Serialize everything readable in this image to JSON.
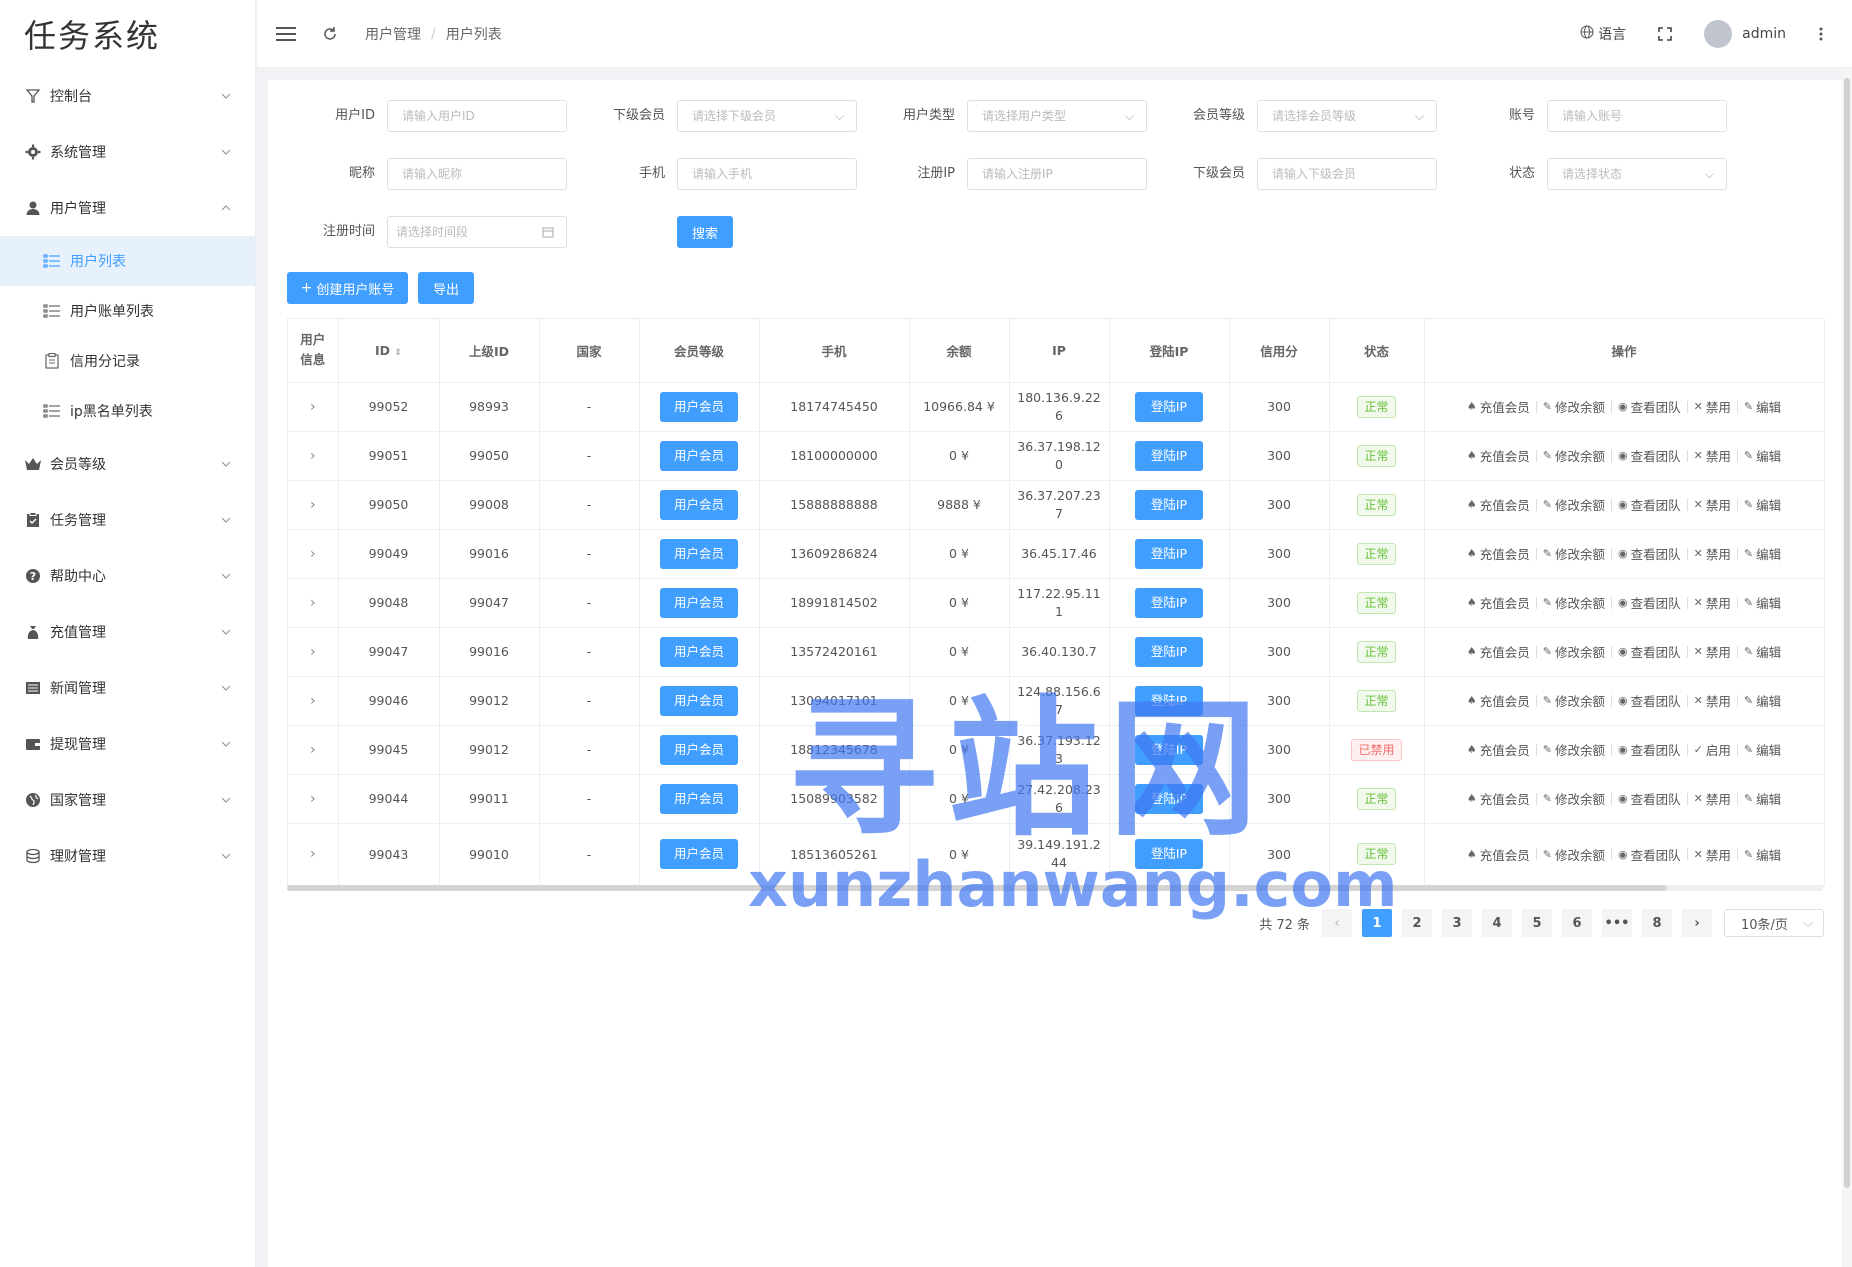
{
  "app": {
    "title": "任务系统"
  },
  "sidebar": {
    "items": [
      {
        "label": "控制台",
        "icon": "dashboard-icon",
        "expanded": false
      },
      {
        "label": "系统管理",
        "icon": "gear-icon",
        "expanded": false
      },
      {
        "label": "用户管理",
        "icon": "user-icon",
        "expanded": true,
        "children": [
          {
            "label": "用户列表",
            "icon": "list-icon",
            "active": true
          },
          {
            "label": "用户账单列表",
            "icon": "list-icon",
            "active": false
          },
          {
            "label": "信用分记录",
            "icon": "clipboard-icon",
            "active": false
          },
          {
            "label": "ip黑名单列表",
            "icon": "list-icon",
            "active": false
          }
        ]
      },
      {
        "label": "会员等级",
        "icon": "crown-icon",
        "expanded": false
      },
      {
        "label": "任务管理",
        "icon": "task-icon",
        "expanded": false
      },
      {
        "label": "帮助中心",
        "icon": "question-icon",
        "expanded": false
      },
      {
        "label": "充值管理",
        "icon": "money-bag-icon",
        "expanded": false
      },
      {
        "label": "新闻管理",
        "icon": "news-icon",
        "expanded": false
      },
      {
        "label": "提现管理",
        "icon": "wallet-icon",
        "expanded": false
      },
      {
        "label": "国家管理",
        "icon": "globe-icon",
        "expanded": false
      },
      {
        "label": "理财管理",
        "icon": "coins-icon",
        "expanded": false
      }
    ]
  },
  "header": {
    "breadcrumb": [
      "用户管理",
      "用户列表"
    ],
    "language_label": "语言",
    "username": "admin"
  },
  "filters": {
    "user_id": {
      "label": "用户ID",
      "placeholder": "请输入用户ID"
    },
    "sub_member": {
      "label": "下级会员",
      "placeholder": "请选择下级会员"
    },
    "user_type": {
      "label": "用户类型",
      "placeholder": "请选择用户类型"
    },
    "member_level": {
      "label": "会员等级",
      "placeholder": "请选择会员等级"
    },
    "account": {
      "label": "账号",
      "placeholder": "请输入账号"
    },
    "nickname": {
      "label": "昵称",
      "placeholder": "请输入昵称"
    },
    "phone": {
      "label": "手机",
      "placeholder": "请输入手机"
    },
    "reg_ip": {
      "label": "注册IP",
      "placeholder": "请输入注册IP"
    },
    "sub_member2": {
      "label": "下级会员",
      "placeholder": "请输入下级会员"
    },
    "status": {
      "label": "状态",
      "placeholder": "请选择状态"
    },
    "reg_time": {
      "label": "注册时间",
      "placeholder": "请选择时间段"
    },
    "search_label": "搜索"
  },
  "toolbar": {
    "create_label": "创建用户账号",
    "export_label": "导出"
  },
  "table": {
    "headers": [
      "用户信息",
      "ID",
      "上级ID",
      "国家",
      "会员等级",
      "手机",
      "余额",
      "IP",
      "登陆IP",
      "信用分",
      "状态",
      "操作"
    ],
    "ops": {
      "recharge": "充值会员",
      "edit_balance": "修改余额",
      "view_team": "查看团队",
      "ban": "禁用",
      "enable": "启用",
      "edit": "编辑"
    },
    "rows": [
      {
        "id": "99052",
        "parent_id": "98993",
        "country": "-",
        "level": "用户会员",
        "phone": "18174745450",
        "balance": "10966.84 ¥",
        "ip": "180.136.9.226",
        "login_ip": "登陆IP",
        "credit": "300",
        "status": "正常",
        "banned": false
      },
      {
        "id": "99051",
        "parent_id": "99050",
        "country": "-",
        "level": "用户会员",
        "phone": "18100000000",
        "balance": "0 ¥",
        "ip": "36.37.198.120",
        "login_ip": "登陆IP",
        "credit": "300",
        "status": "正常",
        "banned": false
      },
      {
        "id": "99050",
        "parent_id": "99008",
        "country": "-",
        "level": "用户会员",
        "phone": "15888888888",
        "balance": "9888 ¥",
        "ip": "36.37.207.237",
        "login_ip": "登陆IP",
        "credit": "300",
        "status": "正常",
        "banned": false
      },
      {
        "id": "99049",
        "parent_id": "99016",
        "country": "-",
        "level": "用户会员",
        "phone": "13609286824",
        "balance": "0 ¥",
        "ip": "36.45.17.46",
        "login_ip": "登陆IP",
        "credit": "300",
        "status": "正常",
        "banned": false
      },
      {
        "id": "99048",
        "parent_id": "99047",
        "country": "-",
        "level": "用户会员",
        "phone": "18991814502",
        "balance": "0 ¥",
        "ip": "117.22.95.111",
        "login_ip": "登陆IP",
        "credit": "300",
        "status": "正常",
        "banned": false
      },
      {
        "id": "99047",
        "parent_id": "99016",
        "country": "-",
        "level": "用户会员",
        "phone": "13572420161",
        "balance": "0 ¥",
        "ip": "36.40.130.7",
        "login_ip": "登陆IP",
        "credit": "300",
        "status": "正常",
        "banned": false
      },
      {
        "id": "99046",
        "parent_id": "99012",
        "country": "-",
        "level": "用户会员",
        "phone": "13094017101",
        "balance": "0 ¥",
        "ip": "124.88.156.67",
        "login_ip": "登陆IP",
        "credit": "300",
        "status": "正常",
        "banned": false
      },
      {
        "id": "99045",
        "parent_id": "99012",
        "country": "-",
        "level": "用户会员",
        "phone": "18812345678",
        "balance": "0 ¥",
        "ip": "36.37.193.123",
        "login_ip": "登陆IP",
        "credit": "300",
        "status": "已禁用",
        "banned": true
      },
      {
        "id": "99044",
        "parent_id": "99011",
        "country": "-",
        "level": "用户会员",
        "phone": "15089903582",
        "balance": "0 ¥",
        "ip": "27.42.208.236",
        "login_ip": "登陆IP",
        "credit": "300",
        "status": "正常",
        "banned": false
      },
      {
        "id": "99043",
        "parent_id": "99010",
        "country": "-",
        "level": "用户会员",
        "phone": "18513605261",
        "balance": "0 ¥",
        "ip": "39.149.191.244",
        "login_ip": "登陆IP",
        "credit": "300",
        "status": "正常",
        "banned": false
      }
    ]
  },
  "pagination": {
    "total_label": "共 72 条",
    "pages": [
      "1",
      "2",
      "3",
      "4",
      "5",
      "6",
      "•••",
      "8"
    ],
    "current": "1",
    "page_size": "10条/页"
  },
  "watermark": {
    "cn": "寻站网",
    "en": "xunzhanwang.com"
  },
  "colors": {
    "primary": "#409eff",
    "success": "#67c23a",
    "danger": "#f56c6c"
  }
}
